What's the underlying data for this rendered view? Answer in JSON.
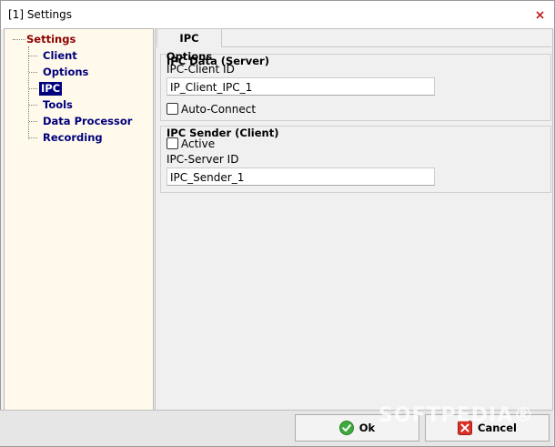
{
  "window": {
    "title": "[1] Settings"
  },
  "tree": {
    "root": "Settings",
    "items": [
      "Client",
      "Options",
      "IPC",
      "Tools",
      "Data Processor",
      "Recording"
    ],
    "selected_index": 2
  },
  "tab": {
    "label": "IPC Options"
  },
  "ipc_data": {
    "title": "IPC Data (Server)",
    "client_id_label": "IPC-Client ID",
    "client_id_value": "IP_Client_IPC_1",
    "auto_connect_label": "Auto-Connect"
  },
  "ipc_sender": {
    "title": "IPC Sender (Client)",
    "active_label": "Active",
    "server_id_label": "IPC-Server ID",
    "server_id_value": "IPC_Sender_1"
  },
  "buttons": {
    "ok_label": "Ok",
    "cancel_label": "Cancel"
  },
  "watermark": "SOFTPEDIA®"
}
